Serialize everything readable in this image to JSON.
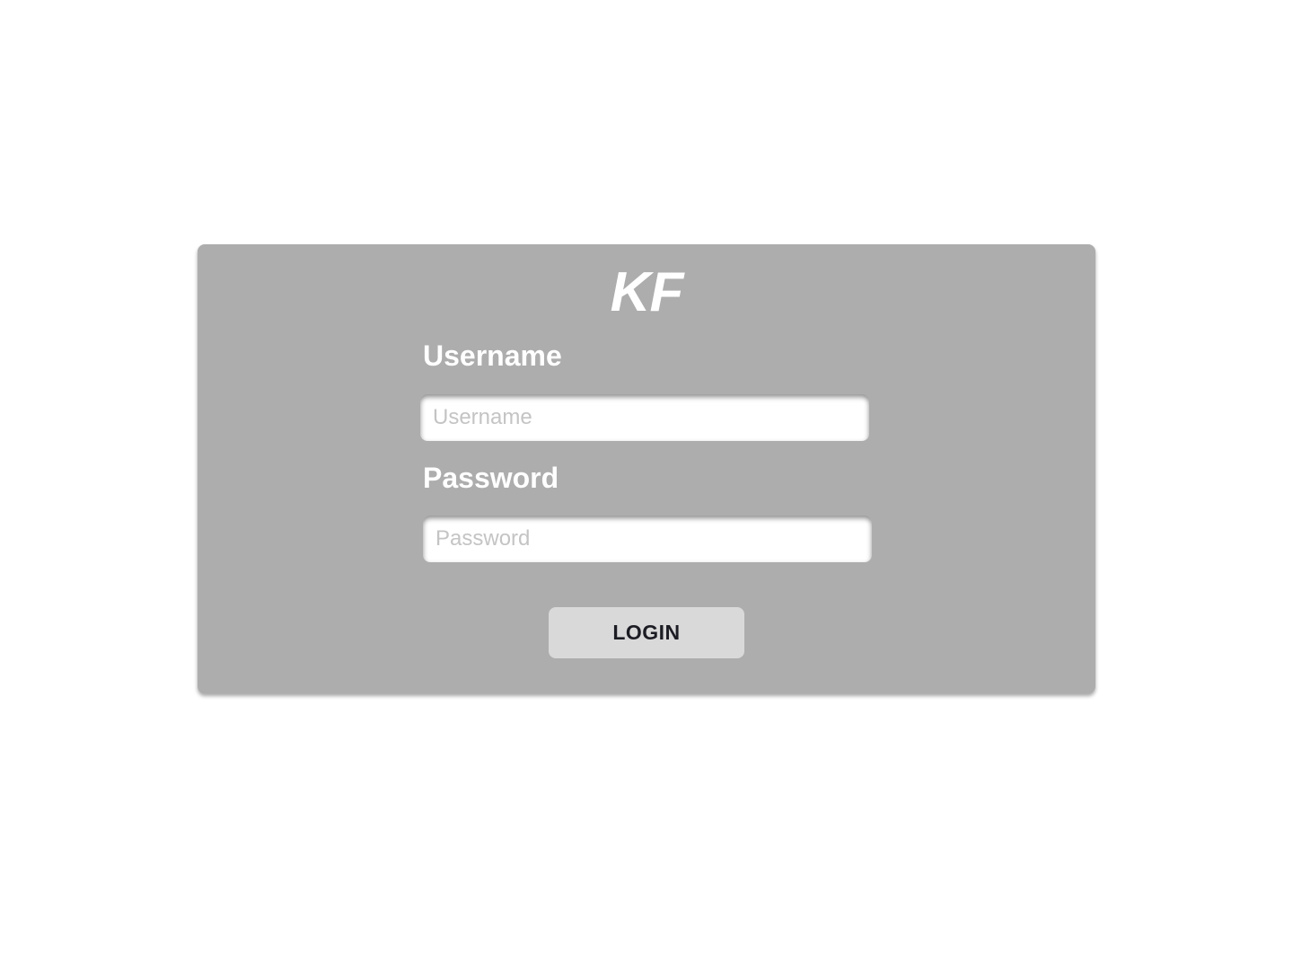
{
  "login_card": {
    "logo_text": "KF",
    "username": {
      "label": "Username",
      "placeholder": "Username",
      "value": ""
    },
    "password": {
      "label": "Password",
      "placeholder": "Password",
      "value": ""
    },
    "login_button_label": "LOGIN"
  },
  "colors": {
    "page_background": "#ffffff",
    "card_background": "#adadad",
    "label_text": "#ffffff",
    "input_background": "#ffffff",
    "placeholder_text": "#c4c4c4",
    "button_background": "#d9d9d9",
    "button_text": "#1c1c24"
  }
}
